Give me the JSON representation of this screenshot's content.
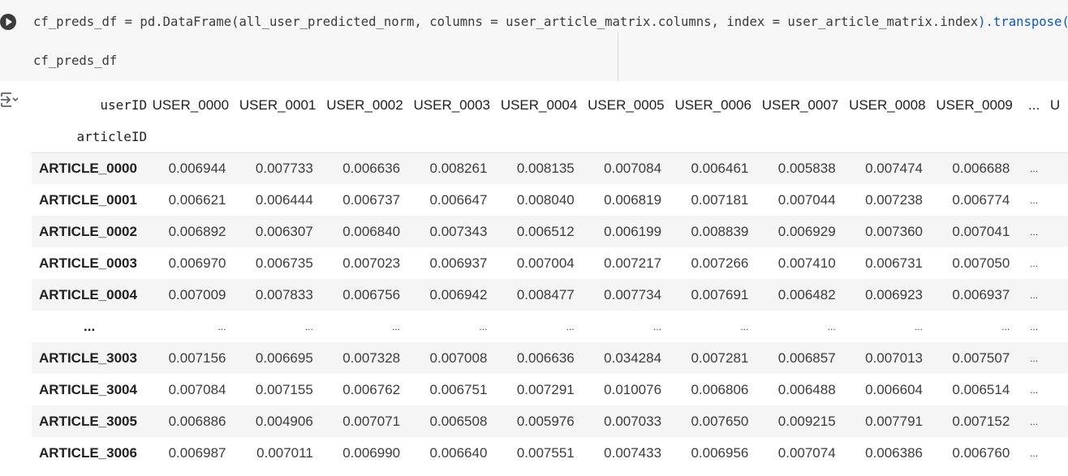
{
  "code": {
    "line1_prefix": "cf_preds_df = pd.DataFrame(all_user_predicted_norm, columns = user_article_matrix.columns, index = user_article_matrix.index",
    "line1_suffix": ").transpose()",
    "line2": "cf_preds_df"
  },
  "table": {
    "columns_name": "userID",
    "index_name": "articleID",
    "columns": [
      "USER_0000",
      "USER_0001",
      "USER_0002",
      "USER_0003",
      "USER_0004",
      "USER_0005",
      "USER_0006",
      "USER_0007",
      "USER_0008",
      "USER_0009",
      "...",
      "U"
    ],
    "rows": [
      {
        "label": "ARTICLE_0000",
        "values": [
          "0.006944",
          "0.007733",
          "0.006636",
          "0.008261",
          "0.008135",
          "0.007084",
          "0.006461",
          "0.005838",
          "0.007474",
          "0.006688",
          "..."
        ]
      },
      {
        "label": "ARTICLE_0001",
        "values": [
          "0.006621",
          "0.006444",
          "0.006737",
          "0.006647",
          "0.008040",
          "0.006819",
          "0.007181",
          "0.007044",
          "0.007238",
          "0.006774",
          "..."
        ]
      },
      {
        "label": "ARTICLE_0002",
        "values": [
          "0.006892",
          "0.006307",
          "0.006840",
          "0.007343",
          "0.006512",
          "0.006199",
          "0.008839",
          "0.006929",
          "0.007360",
          "0.007041",
          "..."
        ]
      },
      {
        "label": "ARTICLE_0003",
        "values": [
          "0.006970",
          "0.006735",
          "0.007023",
          "0.006937",
          "0.007004",
          "0.007217",
          "0.007266",
          "0.007410",
          "0.006731",
          "0.007050",
          "..."
        ]
      },
      {
        "label": "ARTICLE_0004",
        "values": [
          "0.007009",
          "0.007833",
          "0.006756",
          "0.006942",
          "0.008477",
          "0.007734",
          "0.007691",
          "0.006482",
          "0.006923",
          "0.006937",
          "..."
        ]
      },
      {
        "label": "...",
        "values": [
          "...",
          "...",
          "...",
          "...",
          "...",
          "...",
          "...",
          "...",
          "...",
          "...",
          "..."
        ]
      },
      {
        "label": "ARTICLE_3003",
        "values": [
          "0.007156",
          "0.006695",
          "0.007328",
          "0.007008",
          "0.006636",
          "0.034284",
          "0.007281",
          "0.006857",
          "0.007013",
          "0.007507",
          "..."
        ]
      },
      {
        "label": "ARTICLE_3004",
        "values": [
          "0.007084",
          "0.007155",
          "0.006762",
          "0.006751",
          "0.007291",
          "0.010076",
          "0.006806",
          "0.006488",
          "0.006604",
          "0.006514",
          "..."
        ]
      },
      {
        "label": "ARTICLE_3005",
        "values": [
          "0.006886",
          "0.004906",
          "0.007071",
          "0.006508",
          "0.005976",
          "0.007033",
          "0.007650",
          "0.009215",
          "0.007791",
          "0.007152",
          "..."
        ]
      },
      {
        "label": "ARTICLE_3006",
        "values": [
          "0.006987",
          "0.007011",
          "0.006990",
          "0.006640",
          "0.007551",
          "0.007433",
          "0.006956",
          "0.007074",
          "0.006386",
          "0.006760",
          "..."
        ]
      }
    ]
  }
}
